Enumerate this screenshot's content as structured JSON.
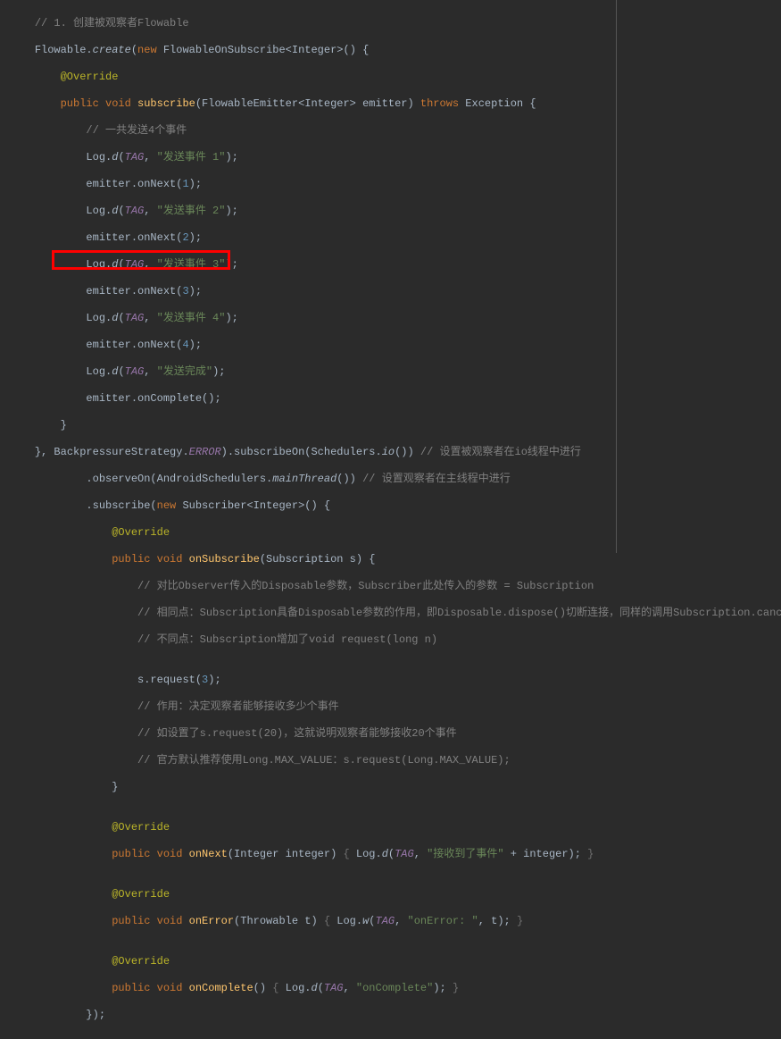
{
  "lines": {
    "l1": "// 1. 创建被观察者Flowable",
    "l2a": "Flowable.",
    "l2b": "create",
    "l2c": "(",
    "l2d": "new",
    "l2e": " FlowableOnSubscribe<Integer>() {",
    "l3": "@Override",
    "l4a": "public void",
    "l4b": " subscribe",
    "l4c": "(FlowableEmitter<Integer> emitter) ",
    "l4d": "throws",
    "l4e": " Exception {",
    "l5": "// 一共发送4个事件",
    "l6a": "Log.",
    "l6b": "d",
    "l6c": "(",
    "l6d": "TAG",
    "l6e": ", ",
    "l6f": "\"发送事件 1\"",
    "l6g": ");",
    "l7a": "emitter.onNext(",
    "l7b": "1",
    "l7c": ");",
    "l8a": "Log.",
    "l8b": "d",
    "l8c": "(",
    "l8d": "TAG",
    "l8e": ", ",
    "l8f": "\"发送事件 2\"",
    "l8g": ");",
    "l9a": "emitter.onNext(",
    "l9b": "2",
    "l9c": ");",
    "l10a": "Log.",
    "l10b": "d",
    "l10c": "(",
    "l10d": "TAG",
    "l10e": ", ",
    "l10f": "\"发送事件 3\"",
    "l10g": ");",
    "l11a": "emitter.onNext(",
    "l11b": "3",
    "l11c": ");",
    "l12a": "Log.",
    "l12b": "d",
    "l12c": "(",
    "l12d": "TAG",
    "l12e": ", ",
    "l12f": "\"发送事件 4\"",
    "l12g": ");",
    "l13a": "emitter.onNext(",
    "l13b": "4",
    "l13c": ");",
    "l14a": "Log.",
    "l14b": "d",
    "l14c": "(",
    "l14d": "TAG",
    "l14e": ", ",
    "l14f": "\"发送完成\"",
    "l14g": ");",
    "l15": "emitter.onComplete();",
    "l16": "}",
    "l17a": "}, BackpressureStrategy.",
    "l17b": "ERROR",
    "l17c": ").subscribeOn(Schedulers.",
    "l17d": "io",
    "l17e": "()) ",
    "l17f": "// 设置被观察者在io线程中进行",
    "l18a": ".observeOn(AndroidSchedulers.",
    "l18b": "mainThread",
    "l18c": "()) ",
    "l18d": "// 设置观察者在主线程中进行",
    "l19a": ".subscribe(",
    "l19b": "new",
    "l19c": " Subscriber<Integer>() {",
    "l20": "@Override",
    "l21a": "public void",
    "l21b": " onSubscribe",
    "l21c": "(Subscription s) {",
    "l22": "// 对比Observer传入的Disposable参数，Subscriber此处传入的参数 = Subscription",
    "l23": "// 相同点：Subscription具备Disposable参数的作用，即Disposable.dispose()切断连接，同样的调用Subscription.canc",
    "l24": "// 不同点：Subscription增加了void request(long n)",
    "l25": "",
    "l26a": "s.request(",
    "l26b": "3",
    "l26c": ");",
    "l27": "// 作用：决定观察者能够接收多少个事件",
    "l28": "// 如设置了s.request(20)，这就说明观察者能够接收20个事件",
    "l29": "// 官方默认推荐使用Long.MAX_VALUE：s.request(Long.MAX_VALUE);",
    "l30": "}",
    "l31": "",
    "l32": "@Override",
    "l33a": "public void",
    "l33b": " onNext",
    "l33c": "(Integer integer) ",
    "l33d": "{",
    "l33e": " Log.",
    "l33f": "d",
    "l33g": "(",
    "l33h": "TAG",
    "l33i": ", ",
    "l33j": "\"接收到了事件\"",
    "l33k": " + integer); ",
    "l33l": "}",
    "l34": "",
    "l35": "@Override",
    "l36a": "public void",
    "l36b": " onError",
    "l36c": "(Throwable t) ",
    "l36d": "{",
    "l36e": " Log.",
    "l36f": "w",
    "l36g": "(",
    "l36h": "TAG",
    "l36i": ", ",
    "l36j": "\"onError: \"",
    "l36k": ", t); ",
    "l36l": "}",
    "l37": "",
    "l38": "@Override",
    "l39a": "public void",
    "l39b": " onComplete",
    "l39c": "() ",
    "l39d": "{",
    "l39e": " Log.",
    "l39f": "d",
    "l39g": "(",
    "l39h": "TAG",
    "l39i": ", ",
    "l39j": "\"onComplete\"",
    "l39k": "); ",
    "l39l": "}",
    "l40": "});"
  }
}
